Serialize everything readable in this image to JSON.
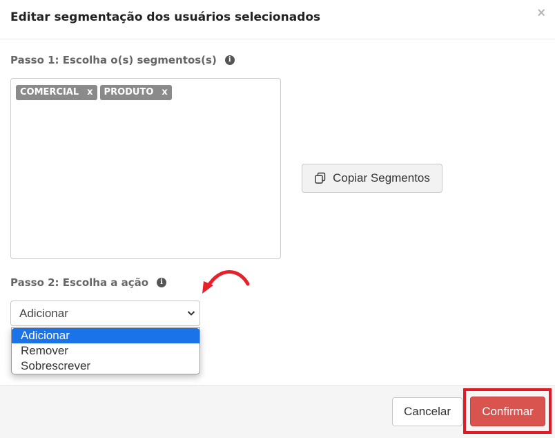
{
  "modal": {
    "title": "Editar segmentação dos usuários selecionados",
    "close_label": "×"
  },
  "step1": {
    "label": "Passo 1: Escolha o(s) segmentos(s)",
    "info_icon": "info-icon",
    "tags": [
      {
        "label": "COMERCIAL",
        "remove": "x"
      },
      {
        "label": "PRODUTO",
        "remove": "x"
      }
    ]
  },
  "copy_button": {
    "label": "Copiar Segmentos",
    "icon": "copy-icon"
  },
  "step2": {
    "label": "Passo 2: Escolha a ação",
    "info_icon": "info-icon",
    "select_value": "Adicionar",
    "options": [
      "Adicionar",
      "Remover",
      "Sobrescrever"
    ],
    "selected_index": 0
  },
  "footer": {
    "cancel_label": "Cancelar",
    "confirm_label": "Confirmar"
  },
  "colors": {
    "confirm": "#d9534f",
    "highlight": "#e01b24",
    "tag": "#8a8a8a",
    "option_selected": "#1a73e8",
    "annotation_arrow": "#e8202a"
  }
}
